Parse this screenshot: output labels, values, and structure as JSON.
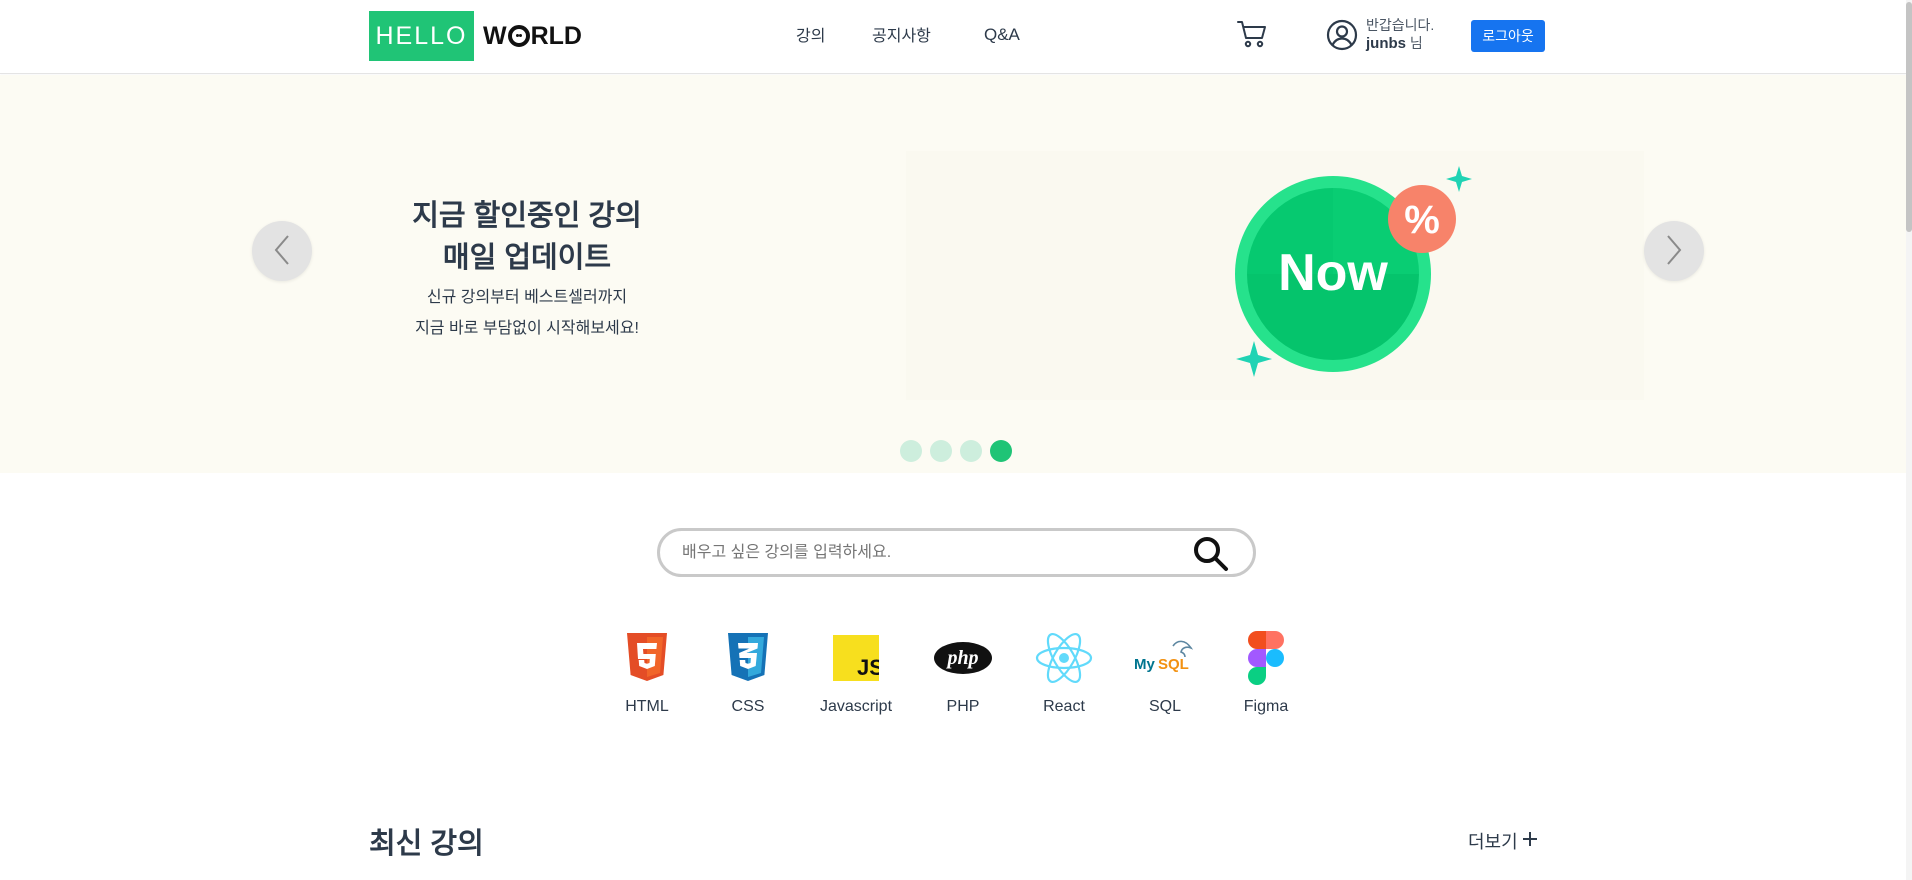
{
  "header": {
    "logo": {
      "left": "HELLO",
      "right_a": "W",
      "right_b": "RLD"
    },
    "nav": [
      {
        "label": "강의"
      },
      {
        "label": "공지사항"
      },
      {
        "label": "Q&A"
      }
    ],
    "greeting": "반갑습니다.",
    "username": "junbs",
    "honorific": "님",
    "logout_label": "로그아웃"
  },
  "hero": {
    "title_line1": "지금 할인중인 강의",
    "title_line2": "매일 업데이트",
    "sub_line1": "신규 강의부터 베스트셀러까지",
    "sub_line2": "지금 바로 부담없이 시작해보세요!",
    "badge_text": "Now",
    "badge_symbol": "%",
    "slide_count": 4,
    "active_slide": 4
  },
  "search": {
    "placeholder": "배우고 싶은 강의를 입력하세요."
  },
  "categories": [
    {
      "label": "HTML",
      "icon": "html5-icon"
    },
    {
      "label": "CSS",
      "icon": "css3-icon"
    },
    {
      "label": "Javascript",
      "icon": "javascript-icon"
    },
    {
      "label": "PHP",
      "icon": "php-icon"
    },
    {
      "label": "React",
      "icon": "react-icon"
    },
    {
      "label": "SQL",
      "icon": "mysql-icon"
    },
    {
      "label": "Figma",
      "icon": "figma-icon"
    }
  ],
  "latest": {
    "title": "최신 강의",
    "more_label": "더보기"
  },
  "colors": {
    "brand_green": "#20c476",
    "logout_blue": "#1674f0",
    "hero_bg": "#fcfbf3",
    "dot_inactive": "#cdeedd",
    "dot_active": "#1fc476"
  }
}
